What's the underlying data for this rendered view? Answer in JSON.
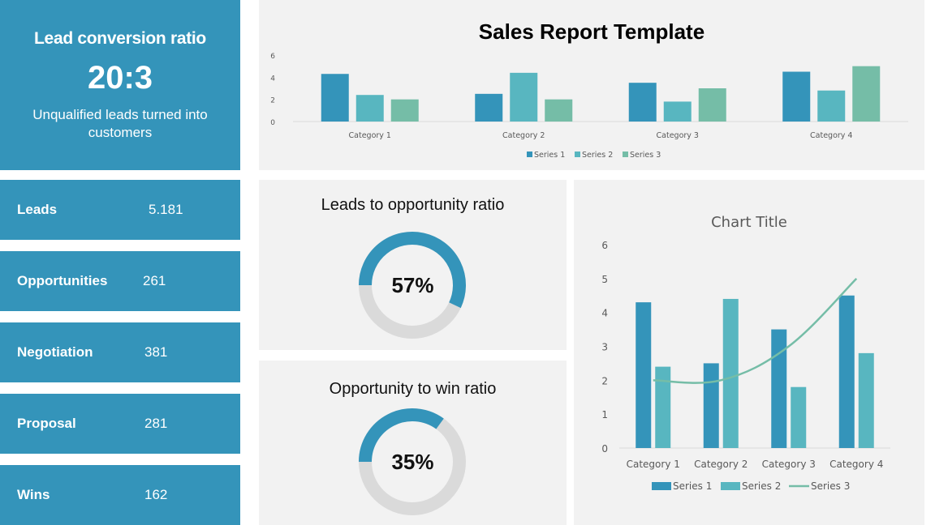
{
  "kpi_main": {
    "title": "Lead conversion ratio",
    "value": "20:3",
    "subtitle": "Unqualified leads turned into customers"
  },
  "stats": [
    {
      "label": "Leads",
      "value": "5.181"
    },
    {
      "label": "Opportunities",
      "value": "261"
    },
    {
      "label": "Negotiation",
      "value": "381"
    },
    {
      "label": "Proposal",
      "value": "281"
    },
    {
      "label": "Wins",
      "value": "162"
    }
  ],
  "ratios": [
    {
      "title": "Leads to opportunity ratio",
      "label": "57%",
      "fraction": 0.57
    },
    {
      "title": "Opportunity to win ratio",
      "label": "35%",
      "fraction": 0.35
    }
  ],
  "colors": {
    "primary": "#3494BA",
    "series1": "#3494BA",
    "series2": "#58B6C0",
    "series3": "#75BDA7",
    "donut_track": "#DADADA",
    "panel": "#F2F2F2"
  },
  "chart_data": [
    {
      "type": "bar",
      "title": "Sales Report Template",
      "categories": [
        "Category 1",
        "Category 2",
        "Category 3",
        "Category 4"
      ],
      "series": [
        {
          "name": "Series 1",
          "values": [
            4.3,
            2.5,
            3.5,
            4.5
          ]
        },
        {
          "name": "Series 2",
          "values": [
            2.4,
            4.4,
            1.8,
            2.8
          ]
        },
        {
          "name": "Series 3",
          "values": [
            2,
            2,
            3,
            5
          ]
        }
      ],
      "yticks": [
        "0",
        "2",
        "4",
        "6"
      ],
      "ylim": [
        0,
        6
      ],
      "xlabel": "",
      "ylabel": "",
      "grid": false,
      "legend": "bottom"
    },
    {
      "type": "bar",
      "title": "Chart Title",
      "categories": [
        "Category 1",
        "Category 2",
        "Category 3",
        "Category 4"
      ],
      "series": [
        {
          "name": "Series 1",
          "type": "bar",
          "values": [
            4.3,
            2.5,
            3.5,
            4.5
          ]
        },
        {
          "name": "Series 2",
          "type": "bar",
          "values": [
            2.4,
            4.4,
            1.8,
            2.8
          ]
        },
        {
          "name": "Series 3",
          "type": "line",
          "values": [
            2,
            2,
            3,
            5
          ]
        }
      ],
      "yticks": [
        "0",
        "1",
        "2",
        "3",
        "4",
        "5",
        "6"
      ],
      "ylim": [
        0,
        6
      ],
      "xlabel": "",
      "ylabel": "",
      "grid": false,
      "legend": "bottom"
    }
  ]
}
